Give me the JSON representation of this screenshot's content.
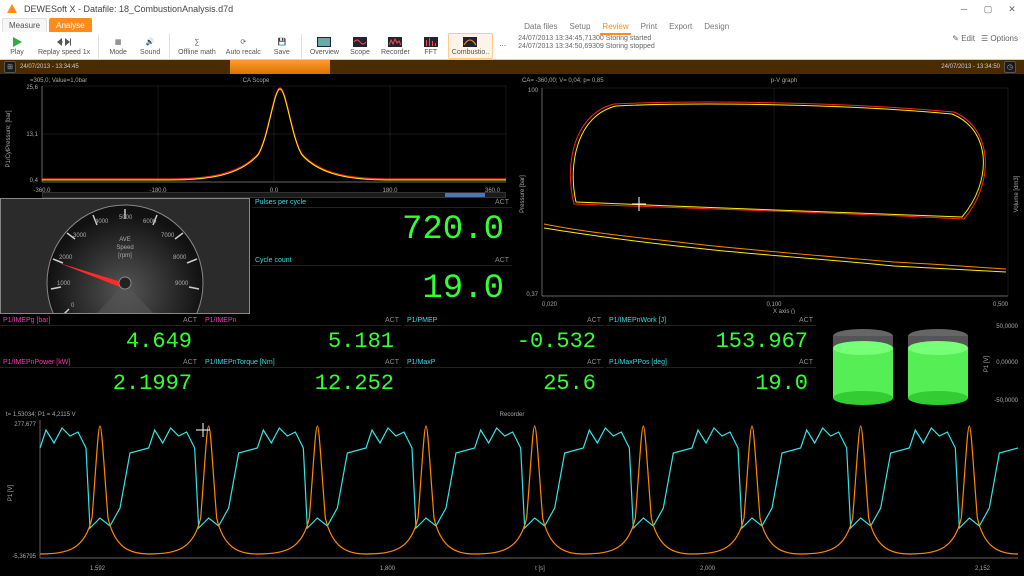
{
  "app": {
    "title": "DEWESoft X - Datafile: 18_CombustionAnalysis.d7d"
  },
  "tabs": {
    "measure": "Measure",
    "analyse": "Analyse"
  },
  "subtabs": {
    "datafiles": "Data files",
    "setup": "Setup",
    "review": "Review",
    "print": "Print",
    "export": "Export",
    "design": "Design"
  },
  "ribbon": {
    "play": "Play",
    "replay": "Replay speed 1x",
    "mode": "Mode",
    "sound": "Sound",
    "offline": "Offline math",
    "autorecalc": "Auto recalc",
    "save": "Save",
    "overview": "Overview",
    "scope": "Scope",
    "recorder": "Recorder",
    "fft": "FFT",
    "combustio": "Combustio..",
    "edit": "Edit",
    "options": "Options"
  },
  "status": {
    "line1": "24/07/2013 13:34:45,71300    Storing started",
    "line2": "24/07/2013 13:34:50,69309    Storing stopped"
  },
  "timestrip": {
    "left": "24/07/2013 - 13:34:45",
    "right": "24/07/2013 - 13:34:50"
  },
  "cascope": {
    "title": "CA Scope",
    "ylabel": "P1/CylPressure; [bar]",
    "cursor": "=305,0; Value=1,0bar",
    "yticks": [
      "25,6",
      "13,1",
      "0,4"
    ],
    "xticks": [
      "-360,0",
      "-180,0",
      "0,0",
      "180,0",
      "360,0"
    ]
  },
  "gauge": {
    "sub1": "AVE",
    "sub2": "Speed",
    "sub3": "[rpm]",
    "ticks": [
      "0",
      "1000",
      "2000",
      "3000",
      "4000",
      "5000",
      "6000",
      "7000",
      "8000",
      "9000"
    ]
  },
  "pulses": {
    "label": "Pulses per cycle",
    "act": "ACT",
    "value": "720.0"
  },
  "cyclecount": {
    "label": "Cycle count",
    "act": "ACT",
    "value": "19.0"
  },
  "pv": {
    "title": "p-V graph",
    "cursor": "CA= -360,00; V= 0,04; p= 0,85",
    "xticks": [
      "0,020",
      "0,100",
      "0,500"
    ],
    "yticks": [
      "0,37",
      "100"
    ],
    "xlabel": "X axis ()",
    "ylabel": "Pressure [bar]",
    "ylabel2": "Volume [dm3]"
  },
  "vals": {
    "v1": {
      "label": "P1/IMEPg [bar]",
      "act": "ACT",
      "value": "4.649",
      "labelcolor": "titlemag"
    },
    "v2": {
      "label": "P1/IMEPn",
      "act": "ACT",
      "value": "5.181",
      "labelcolor": "titlemag"
    },
    "v3": {
      "label": "P1/PMEP",
      "act": "ACT",
      "value": "-0.532",
      "labelcolor": "titlecyan"
    },
    "v4": {
      "label": "P1/IMEPnWork [J]",
      "act": "ACT",
      "value": "153.967",
      "labelcolor": "titlecyan"
    },
    "v5": {
      "label": "P1/IMEPnPower [kW]",
      "act": "ACT",
      "value": "2.1997",
      "labelcolor": "titlemag"
    },
    "v6": {
      "label": "P1/IMEPnTorque [Nm]",
      "act": "ACT",
      "value": "12.252",
      "labelcolor": "titlecyan"
    },
    "v7": {
      "label": "P1/MaxP",
      "act": "ACT",
      "value": "25.6",
      "labelcolor": "titlecyan"
    },
    "v8": {
      "label": "P1/MaxPPos [deg]",
      "act": "ACT",
      "value": "19.0",
      "labelcolor": "titlecyan"
    }
  },
  "bars": {
    "yticks": [
      "50,0000",
      "0,00000",
      "-50,0000"
    ],
    "ylabel": "P1 [V]"
  },
  "recorder": {
    "title": "Recorder",
    "ylabel": "P1 [V]",
    "cursor": "t= 1,53034; P1 = 4,2115 V",
    "yticks": [
      "277,677",
      "-5,36795"
    ],
    "xticks": [
      "1,592",
      "1,800",
      "t [s]",
      "2,000",
      "2,152"
    ]
  }
}
